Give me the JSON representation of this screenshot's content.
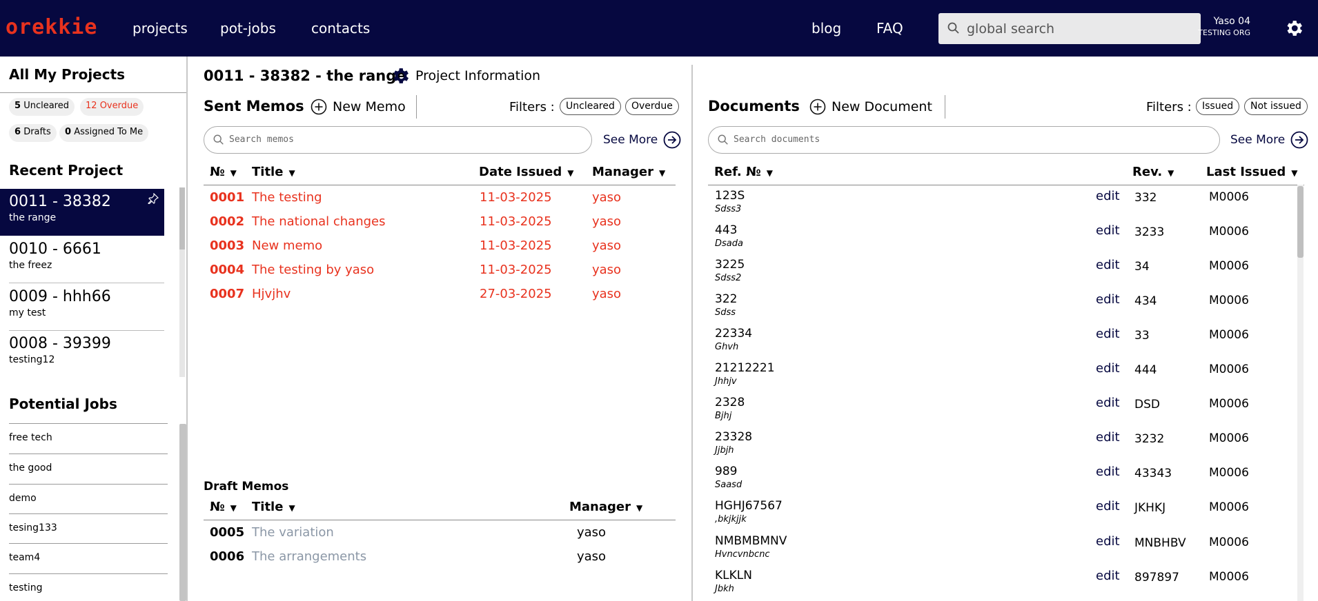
{
  "header": {
    "logo": "orekkie",
    "nav_left": [
      "projects",
      "pot-jobs",
      "contacts"
    ],
    "nav_right": [
      "blog",
      "FAQ"
    ],
    "search_placeholder": "global search",
    "user_name": "Yaso 04",
    "user_org": "TESTING ORG"
  },
  "sidebar": {
    "all_projects_title": "All My Projects",
    "uncleared_count": "5",
    "uncleared_label": "Uncleared",
    "overdue_count": "12",
    "overdue_label": "Overdue",
    "drafts_count": "6",
    "drafts_label": "Drafts",
    "assigned_count": "0",
    "assigned_label": "Assigned To Me",
    "recent_title": "Recent Project",
    "projects": [
      {
        "title": "0011 - 38382",
        "sub": "the range"
      },
      {
        "title": "0010 - 6661",
        "sub": "the freez"
      },
      {
        "title": "0009 - hhh66",
        "sub": "my test"
      },
      {
        "title": "0008 - 39399",
        "sub": "testing12"
      }
    ],
    "potential_title": "Potential Jobs",
    "potential_jobs": [
      "free tech",
      "the good",
      "demo",
      "tesing133",
      "team4",
      "testing"
    ]
  },
  "project": {
    "title": "0011 - 38382 - the range",
    "info_label": "Project Information"
  },
  "memos": {
    "title": "Sent Memos",
    "new_label": "New Memo",
    "filters_label": "Filters :",
    "filter_1": "Uncleared",
    "filter_2": "Overdue",
    "search_placeholder": "Search memos",
    "see_more": "See More",
    "col_no": "№",
    "col_title": "Title",
    "col_date": "Date Issued",
    "col_manager": "Manager",
    "rows": [
      {
        "no": "0001",
        "title": "The testing",
        "date": "11-03-2025",
        "manager": "yaso"
      },
      {
        "no": "0002",
        "title": "The national changes",
        "date": "11-03-2025",
        "manager": "yaso"
      },
      {
        "no": "0003",
        "title": "New memo",
        "date": "11-03-2025",
        "manager": "yaso"
      },
      {
        "no": "0004",
        "title": "The testing by yaso",
        "date": "11-03-2025",
        "manager": "yaso"
      },
      {
        "no": "0007",
        "title": "Hjvjhv",
        "date": "27-03-2025",
        "manager": "yaso"
      }
    ]
  },
  "drafts": {
    "title": "Draft Memos",
    "col_no": "№",
    "col_title": "Title",
    "col_manager": "Manager",
    "rows": [
      {
        "no": "0005",
        "title": "The variation",
        "manager": "yaso"
      },
      {
        "no": "0006",
        "title": "The arrangements",
        "manager": "yaso"
      }
    ]
  },
  "documents": {
    "title": "Documents",
    "new_label": "New Document",
    "filters_label": "Filters :",
    "filter_1": "Issued",
    "filter_2": "Not issued",
    "search_placeholder": "Search documents",
    "see_more": "See More",
    "col_ref": "Ref. №",
    "col_rev": "Rev.",
    "col_last": "Last Issued",
    "edit_label": "edit",
    "rows": [
      {
        "ref": "123S",
        "sub": "Sdss3",
        "rev": "332",
        "last": "M0006"
      },
      {
        "ref": "443",
        "sub": "Dsada",
        "rev": "3233",
        "last": "M0006"
      },
      {
        "ref": "3225",
        "sub": "Sdss2",
        "rev": "34",
        "last": "M0006"
      },
      {
        "ref": "322",
        "sub": "Sdss",
        "rev": "434",
        "last": "M0006"
      },
      {
        "ref": "22334",
        "sub": "Ghvh",
        "rev": "33",
        "last": "M0006"
      },
      {
        "ref": "21212221",
        "sub": "Jhhjv",
        "rev": "444",
        "last": "M0006"
      },
      {
        "ref": "2328",
        "sub": "Bjhj",
        "rev": "DSD",
        "last": "M0006"
      },
      {
        "ref": "23328",
        "sub": "Jjbjh",
        "rev": "3232",
        "last": "M0006"
      },
      {
        "ref": "989",
        "sub": "Saasd",
        "rev": "43343",
        "last": "M0006"
      },
      {
        "ref": "HGHJ67567",
        "sub": ",bkjkjjk",
        "rev": "JKHKJ",
        "last": "M0006"
      },
      {
        "ref": "NMBMBMNV",
        "sub": "Hvncvnbcnc",
        "rev": "MNBHBV",
        "last": "M0006"
      },
      {
        "ref": "KLKLN",
        "sub": "Jbkh",
        "rev": "897897",
        "last": "M0006"
      }
    ]
  },
  "colors": {
    "navy": "#060840",
    "accent_red": "#e8321e",
    "muted": "#8b97a6"
  }
}
